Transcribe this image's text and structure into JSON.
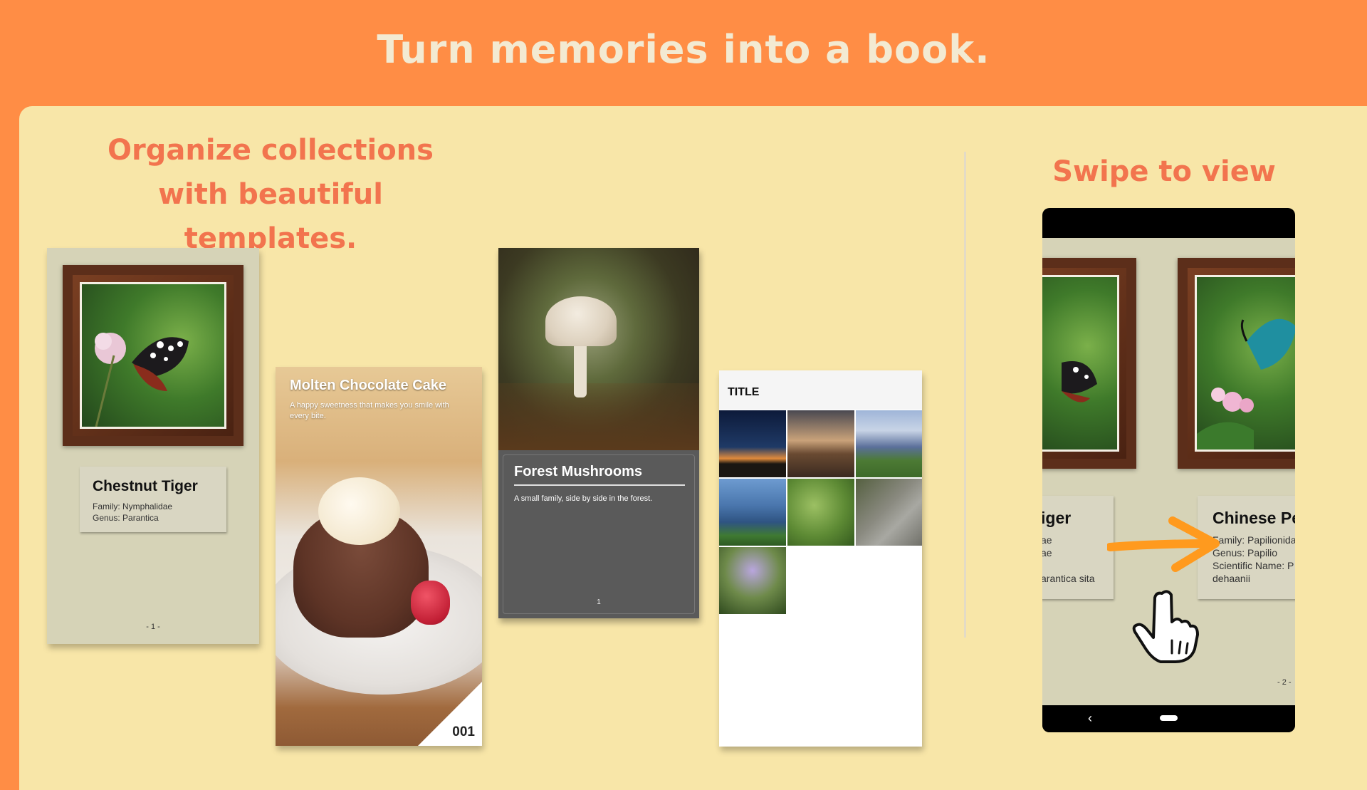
{
  "headline": "Turn memories into a book.",
  "left_heading": {
    "line1": "Organize collections",
    "line2": "with beautiful templates."
  },
  "right_heading": "Swipe to view",
  "templates": [
    {
      "type": "framed-specimen",
      "title": "Chestnut Tiger",
      "lines": [
        "Family: Nymphalidae",
        "Genus: Parantica"
      ],
      "page": "- 1 -"
    },
    {
      "type": "photo-cover",
      "title": "Molten Chocolate Cake",
      "subtitle": "A happy sweetness that makes you smile with every bite.",
      "number": "001"
    },
    {
      "type": "dark-card",
      "title": "Forest Mushrooms",
      "subtitle": "A small family, side by side in the forest.",
      "page": "1"
    },
    {
      "type": "photo-grid",
      "title": "TITLE",
      "tiles": 7
    }
  ],
  "phone": {
    "left_page": {
      "title": "iger",
      "lines": [
        "ae",
        "ae",
        "",
        "arantica sita"
      ]
    },
    "right_page": {
      "title": "Chinese Pe",
      "lines": [
        "Family: Papilionida",
        "Genus: Papilio",
        "Scientific Name: P",
        "dehaanii"
      ],
      "page": "- 2 -"
    },
    "nav": {
      "back": "‹"
    }
  },
  "icons": [
    "swipe-arrow-icon",
    "pointing-hand-icon",
    "back-icon",
    "home-pill-icon"
  ],
  "colors": {
    "top_band": "#FF8D45",
    "panel": "#F8E6A8",
    "heading": "#F2744E",
    "arrow": "#FF9A1E"
  }
}
